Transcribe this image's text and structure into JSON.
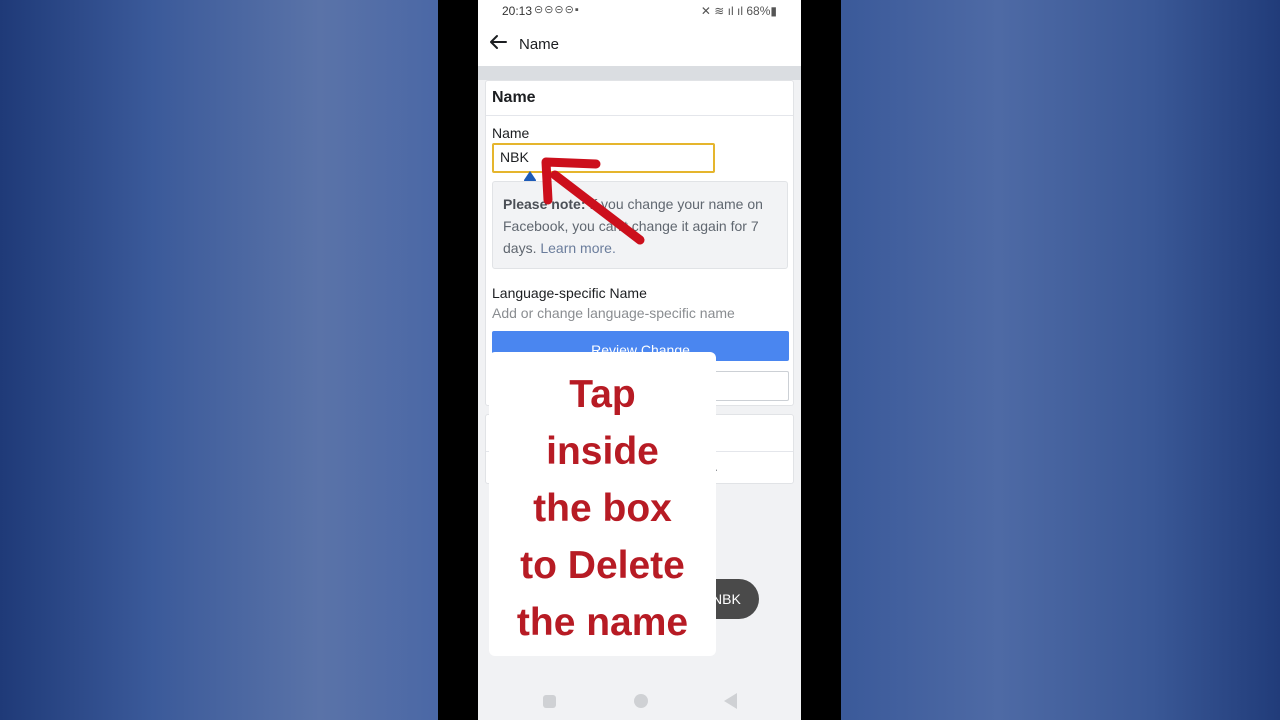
{
  "status_bar": {
    "time": "20:13",
    "battery": "68%",
    "left_icons": [
      "notification-icon",
      "notification-icon",
      "notification-icon",
      "notification-icon",
      "notification-icon"
    ],
    "right_icons": [
      "mute-icon",
      "wifi-icon",
      "signal-icon",
      "signal-icon",
      "battery-icon"
    ]
  },
  "app_bar": {
    "title": "Name",
    "back_icon": "back-arrow-icon"
  },
  "name_card": {
    "title": "Name",
    "field_label": "Name",
    "field_value": "NBK",
    "note_bold": "Please note:",
    "note_text": " If you change your name on Facebook, you can't change it again for 7 days.",
    "note_link": "Learn more.",
    "lang_label": "Language-specific Name",
    "lang_sub": "Add or change language-specific name",
    "review_button": "Review Change"
  },
  "second_card": {
    "partial_text": "c."
  },
  "toast": {
    "text": "NBK"
  },
  "overlay": {
    "instruction": "Tap\ninside\nthe box\nto Delete\nthe name"
  },
  "colors": {
    "accent": "#4a86f0",
    "input_border": "#e5b52d",
    "annotation_red": "#b71b24",
    "cursor_handle": "#1e5bb8"
  }
}
